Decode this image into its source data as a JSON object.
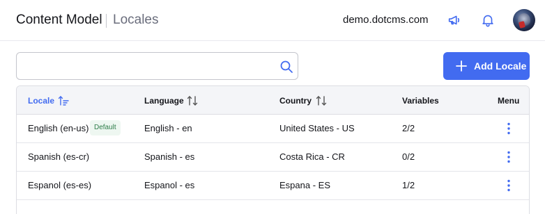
{
  "header": {
    "title": "Content Model",
    "current": "Locales",
    "site": "demo.dotcms.com",
    "icons": [
      "megaphone-icon",
      "bell-icon"
    ],
    "accent_color": "#426bf0"
  },
  "toolbar": {
    "search_placeholder": "",
    "search_value": "",
    "add_label": "Add Locale"
  },
  "table": {
    "columns": {
      "locale": "Locale",
      "language": "Language",
      "country": "Country",
      "variables": "Variables",
      "menu": "Menu"
    },
    "sorted_column": "Locale",
    "rows": [
      {
        "locale": "English (en-us)",
        "badge": "Default",
        "language": "English - en",
        "country": "United States - US",
        "variables": "2/2"
      },
      {
        "locale": "Spanish (es-cr)",
        "badge": "",
        "language": "Spanish - es",
        "country": "Costa Rica - CR",
        "variables": "0/2"
      },
      {
        "locale": "Espanol (es-es)",
        "badge": "",
        "language": "Espanol - es",
        "country": "Espana - ES",
        "variables": "1/2"
      }
    ]
  }
}
